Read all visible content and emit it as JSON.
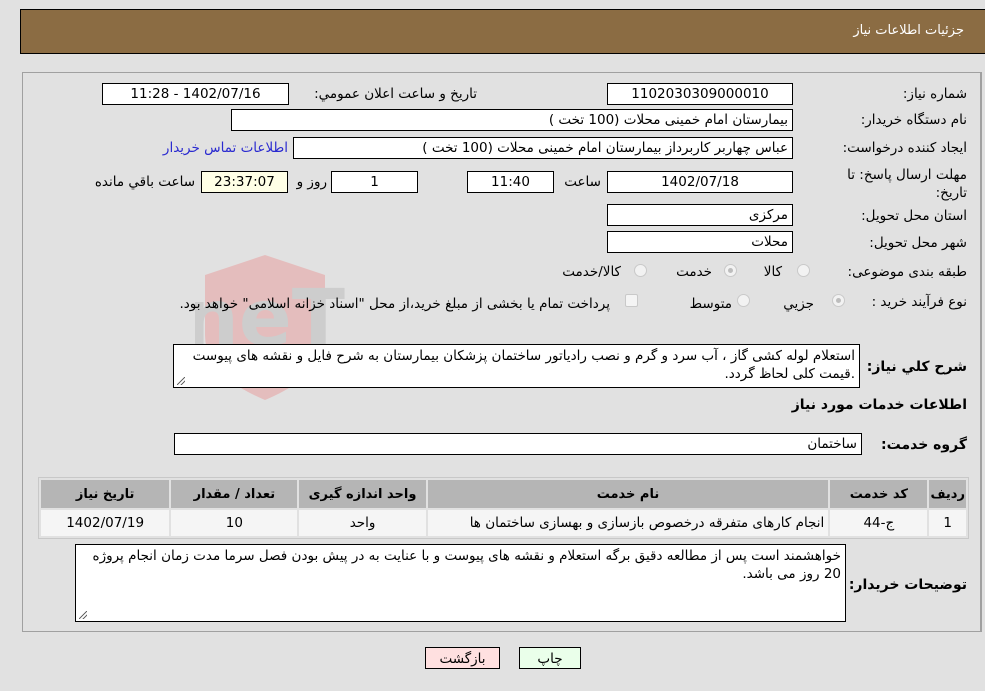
{
  "header": {
    "title": "جزئیات اطلاعات نیاز"
  },
  "form": {
    "need_number": {
      "label": "شماره نیاز:",
      "value": "1102030309000010"
    },
    "announce_datetime": {
      "label": "تاریخ و ساعت اعلان عمومي:",
      "value": "1402/07/16 - 11:28"
    },
    "buyer_org": {
      "label": "نام دستگاه خریدار:",
      "value": "بیمارستان امام خمینی محلات (100 تخت )"
    },
    "requester": {
      "label": "ایجاد کننده درخواست:",
      "value": "عباس چهاربر کاربرداز  بیمارستان امام خمینی محلات (100 تخت )"
    },
    "buyer_contact_link": "اطلاعات تماس خریدار",
    "deadline": {
      "label": "مهلت ارسال پاسخ: تا تاریخ:",
      "date": "1402/07/18",
      "time_label": "ساعت",
      "time": "11:40",
      "days": "1",
      "days_label": "روز و",
      "remaining": "23:37:07",
      "remaining_label": "ساعت باقي مانده"
    },
    "province": {
      "label": "استان محل تحویل:",
      "value": "مرکزی"
    },
    "city": {
      "label": "شهر محل تحویل:",
      "value": "محلات"
    },
    "category": {
      "label": "طبقه بندی موضوعی:",
      "options": [
        "کالا",
        "خدمت",
        "کالا/خدمت"
      ],
      "selected": "خدمت"
    },
    "purchase_process": {
      "label": "نوع فرآیند خرید :",
      "options": [
        "جزيي",
        "متوسط"
      ],
      "selected": "جزيي",
      "treasury_note": "پرداخت تمام یا بخشی از مبلغ خرید،از محل \"اسناد خزانه اسلامی\" خواهد بود."
    },
    "general_description": {
      "label": "شرح کلي نياز:",
      "value": "استعلام لوله کشی گاز ، آب سرد و گرم  و نصب رادیاتور ساختمان پزشکان بیمارستان به شرح فایل و نقشه های پیوست .قیمت کلی لحاظ گردد."
    }
  },
  "services_section": {
    "title": "اطلاعات خدمات مورد نیاز",
    "service_group": {
      "label": "گروه خدمت:",
      "value": "ساختمان"
    },
    "table": {
      "headers": [
        "ردیف",
        "کد خدمت",
        "نام خدمت",
        "واحد اندازه گیری",
        "تعداد / مقدار",
        "تاریخ نیاز"
      ],
      "rows": [
        [
          "1",
          "ج-44",
          "انجام کارهای متفرقه درخصوص بازسازی و بهسازی ساختمان ها",
          "واحد",
          "10",
          "1402/07/19"
        ]
      ]
    }
  },
  "buyer_notes": {
    "label": "توضیحات خریدار:",
    "value": "خواهشمند است پس از مطالعه دقیق برگه استعلام و نقشه های پیوست و با عنایت به در پیش بودن فصل سرما مدت زمان انجام  پروژه 20 روز می باشد."
  },
  "buttons": {
    "print": "چاپ",
    "back": "بازگشت"
  },
  "colors": {
    "header": "#8b6c43",
    "print_bg": "#eaffea",
    "back_bg": "#ffe0e0",
    "link": "#2a2ad0"
  }
}
